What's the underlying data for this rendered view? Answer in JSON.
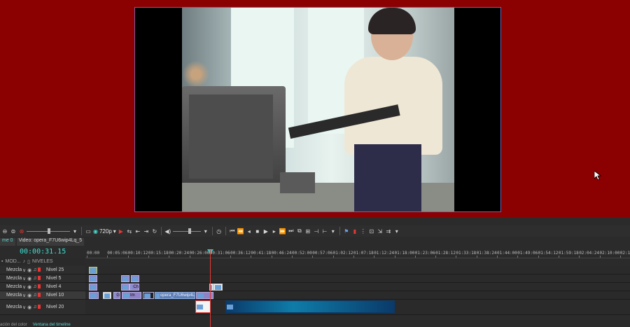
{
  "toolbar": {
    "resolution_label": "720p",
    "items": [
      "undo-icon",
      "redo-icon",
      "record-icon",
      "zoom-slider",
      "dropdown-icon",
      "view-mode-icon",
      "resolution-select",
      "record-toggle",
      "loop-icon",
      "prev-icon",
      "next-icon",
      "refresh-icon",
      "volume-icon",
      "volume-slider",
      "clock-icon",
      "to-start-icon",
      "step-back-icon",
      "prev-frame-icon",
      "play-icon",
      "next-frame-icon",
      "step-forward-icon",
      "to-end-icon",
      "grid-icon",
      "split-icon",
      "marker-icon",
      "snap-icon",
      "ripple-icon",
      "link-icon"
    ]
  },
  "left_panel": {
    "tab_project": "me 0",
    "tab_video": "Video: opera_F7U6wip4Lq_5",
    "timecode": "00:00:31.15",
    "header_mode": "MOD...",
    "header_levels": "NIVELES"
  },
  "ruler": {
    "labels": [
      "00:00",
      "00:05:06",
      "00:10:12",
      "00:15:18",
      "00:20:24",
      "00:26:00",
      "00:31:06",
      "00:36:12",
      "00:41:18",
      "00:46:24",
      "00:52:00",
      "00:57:06",
      "01:02:12",
      "01:07:18",
      "01:12:24",
      "01:18:00",
      "01:23:06",
      "01:28:12",
      "01:33:18",
      "01:38:24",
      "01:44:00",
      "01:49:06",
      "01:54:12",
      "01:59:18",
      "02:04:24",
      "02:10:00",
      "02:15:06"
    ]
  },
  "tracks": [
    {
      "mode": "Mezcla",
      "name": "Nivel 25"
    },
    {
      "mode": "Mezcla",
      "name": "Nivel 5"
    },
    {
      "mode": "Mezcla",
      "name": "Nivel 4"
    },
    {
      "mode": "Mezcla",
      "name": "Nivel 10"
    },
    {
      "mode": "Mezcla",
      "name": "Nivel 20"
    }
  ],
  "clips": {
    "nivel4_label": "Ch",
    "nivel10_g": "G",
    "nivel10_im": "Im",
    "nivel10_video": "opera_F7U6wip4L"
  },
  "footer": {
    "tab_color": "ación del color",
    "tab_timeline": "Ventana del timeline"
  },
  "colors": {
    "background": "#8b0000",
    "accent": "#3fe0d0",
    "playhead": "#e53935"
  }
}
